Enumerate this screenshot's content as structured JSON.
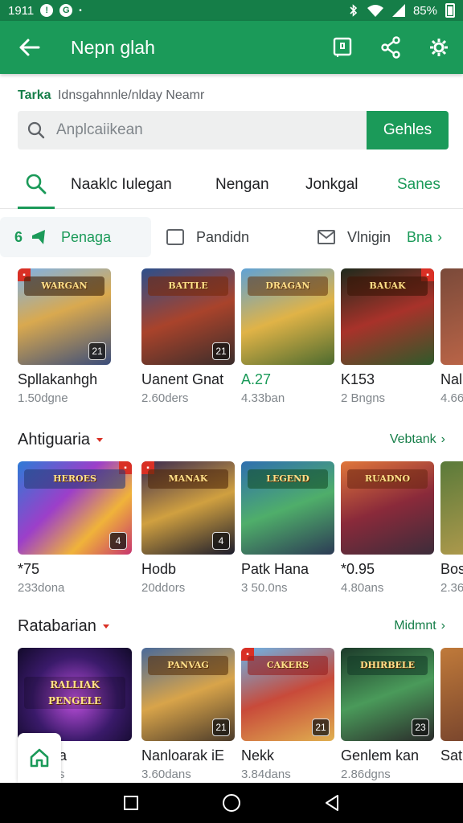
{
  "status_bar": {
    "time": "1911",
    "battery": "85%"
  },
  "app_bar": {
    "title": "Nepn glah"
  },
  "search": {
    "breadcrumb_lead": "Tarka",
    "breadcrumb": "Idnsgahnnle/nlday Neamr",
    "placeholder": "Anplcaiikean",
    "button_label": "Gehles"
  },
  "tabs": [
    {
      "label": "Naaklc Iulegan"
    },
    {
      "label": "Nengan"
    },
    {
      "label": "Jonkgal"
    },
    {
      "label": "Sanes"
    }
  ],
  "chips": [
    {
      "label": "Penaga",
      "prefix": "6"
    },
    {
      "label": "Pandidn"
    },
    {
      "label": "Vlnigin"
    }
  ],
  "chips_more": "Bna",
  "featured": [
    {
      "title": "Spllakanhgh",
      "sub": "1.50dgne",
      "logo": "WARGAN",
      "badge": "21"
    },
    {
      "title": "Uanent Gnat",
      "sub": "2.60ders",
      "logo": "BATTLE",
      "badge": "21"
    },
    {
      "title": "A.27",
      "sub": "4.33ban",
      "logo": "DRAGAN",
      "badge": ""
    },
    {
      "title": "K153",
      "sub": "2 Bngns",
      "logo": "BAUAK",
      "badge": ""
    },
    {
      "title": "Nal",
      "sub": "4.66",
      "logo": "",
      "badge": ""
    }
  ],
  "section1": {
    "title": "Ahtiguaria",
    "link": "Vebtank"
  },
  "section1_items": [
    {
      "title": "*75",
      "sub": "233dona",
      "logo": "HEROES",
      "badge": "4"
    },
    {
      "title": "Hodb",
      "sub": "20ddors",
      "logo": "MANAK",
      "badge": "4"
    },
    {
      "title": "Patk Hana",
      "sub": "3 50.0ns",
      "logo": "LEGEND",
      "badge": ""
    },
    {
      "title": "*0.95",
      "sub": "4.80ans",
      "logo": "RUADNO",
      "badge": ""
    },
    {
      "title": "Bos",
      "sub": "2.36",
      "logo": "",
      "badge": ""
    }
  ],
  "section2": {
    "title": "Ratabarian",
    "link": "Midmnt"
  },
  "section2_items": [
    {
      "title": "Iloliogia",
      "sub": "2.30ders",
      "logo": "RALLIAK PENGELE",
      "badge": ""
    },
    {
      "title": "Nanloarak iE",
      "sub": "3.60dans",
      "logo": "PANVAG",
      "badge": "21"
    },
    {
      "title": "Nekk",
      "sub": "3.84dans",
      "logo": "CAKERS",
      "badge": "21"
    },
    {
      "title": "Genlem kan",
      "sub": "2.86dgns",
      "logo": "DHIRBELE",
      "badge": "23"
    },
    {
      "title": "Sat",
      "sub": "",
      "logo": "",
      "badge": ""
    }
  ],
  "colors": {
    "primary": "#1b9a59",
    "status_bar": "#157e48",
    "accent_red": "#d93025"
  }
}
